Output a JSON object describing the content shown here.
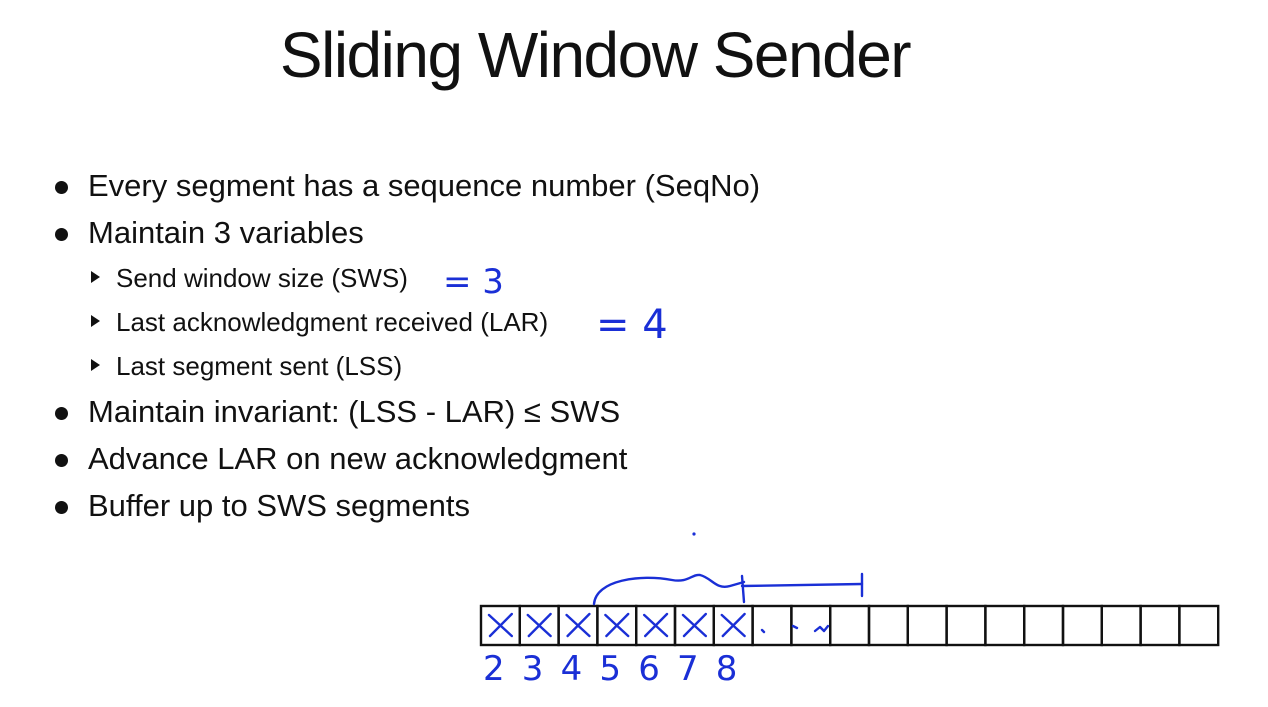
{
  "slide": {
    "title": "Sliding Window Sender",
    "bullets": [
      {
        "level": 1,
        "text": "Every segment has a sequence number (SeqNo)"
      },
      {
        "level": 1,
        "text": "Maintain 3 variables"
      },
      {
        "level": 2,
        "text": "Send window size (SWS)"
      },
      {
        "level": 2,
        "text": "Last acknowledgment received (LAR)"
      },
      {
        "level": 2,
        "text": "Last segment sent (LSS)"
      },
      {
        "level": 1,
        "text": "Maintain invariant: (LSS - LAR) ≤ SWS"
      },
      {
        "level": 1,
        "text": "Advance LAR on new acknowledgment"
      },
      {
        "level": 1,
        "text": "Buffer up to SWS segments"
      }
    ]
  },
  "annotations": {
    "sws_value": "= 3",
    "lar_value": "= 4",
    "segment_numbers": [
      "2",
      "3",
      "4",
      "5",
      "6",
      "7",
      "8"
    ]
  },
  "buffer": {
    "cell_count": 19,
    "marked_cells": 7
  },
  "colors": {
    "ink": "#1a2fd6",
    "text": "#111111",
    "background": "#ffffff"
  }
}
